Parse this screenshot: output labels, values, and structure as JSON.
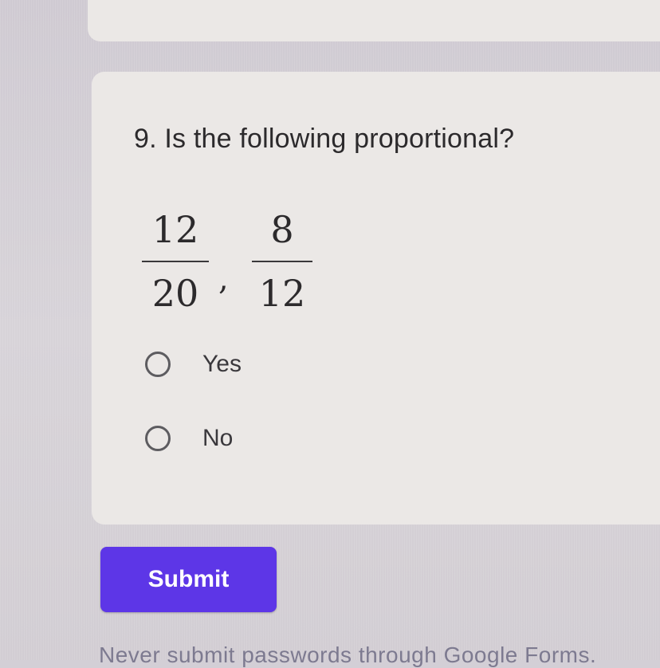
{
  "question": {
    "title": "9. Is the following proportional?",
    "fractions": [
      {
        "numerator": "12",
        "denominator": "20"
      },
      {
        "numerator": "8",
        "denominator": "12"
      }
    ],
    "separator": ",",
    "options": [
      {
        "label": "Yes",
        "selected": false
      },
      {
        "label": "No",
        "selected": false
      }
    ]
  },
  "submit": {
    "label": "Submit"
  },
  "footer": {
    "note": "Never submit passwords through Google Forms."
  },
  "colors": {
    "accent": "#5d36e7",
    "card": "#ebe8e6",
    "text": "#2c2a2c"
  }
}
